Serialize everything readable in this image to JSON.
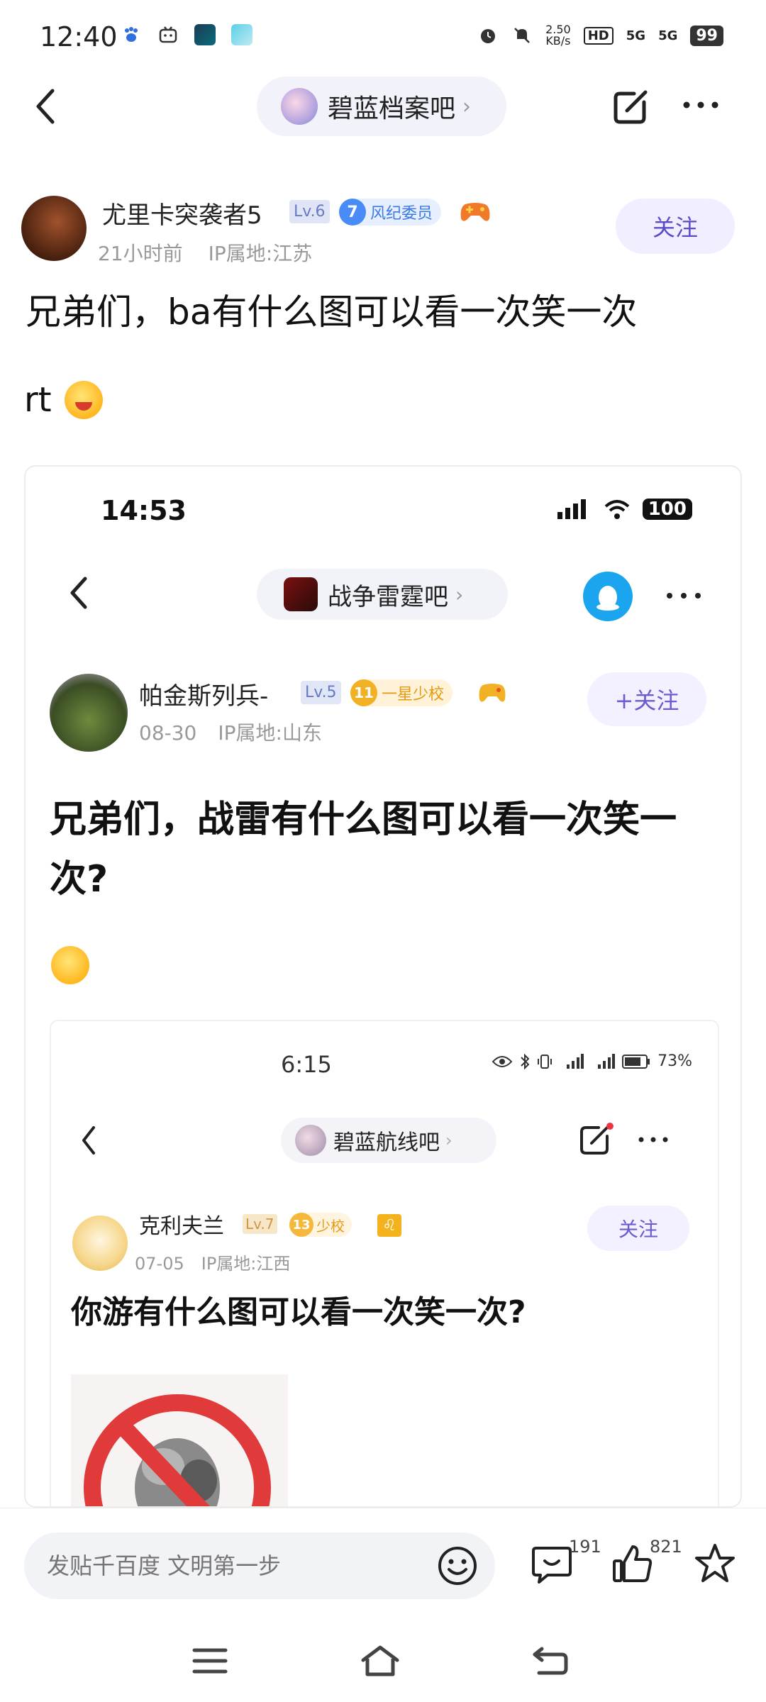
{
  "status_bar": {
    "time": "12:40",
    "net_speed_top": "2.50",
    "net_speed_bottom": "KB/s",
    "hd": "HD",
    "net1": "5G",
    "net2": "5G",
    "battery": "99"
  },
  "nav": {
    "forum_name": "碧蓝档案吧",
    "chevron": "›"
  },
  "post": {
    "author": "尤里卡突袭者5",
    "level": "Lv.6",
    "honor_level": "7",
    "honor_title": "风纪委员",
    "follow_label": "关注",
    "time_ago": "21小时前",
    "ip": "IP属地:江苏",
    "title": "兄弟们，ba有什么图可以看一次笑一次",
    "body": "rt"
  },
  "embedded_1": {
    "time": "14:53",
    "battery": "100",
    "forum_name": "战争雷霆吧",
    "chevron": "›",
    "author": "帕金斯列兵-",
    "level": "Lv.5",
    "rank_num": "11",
    "rank_title": "一星少校",
    "follow_label": "+关注",
    "date": "08-30",
    "ip": "IP属地:山东",
    "title": "兄弟们，战雷有什么图可以看一次笑一次?"
  },
  "embedded_2": {
    "time": "6:15",
    "battery": "73%",
    "forum_name": "碧蓝航线吧",
    "chevron": "›",
    "author": "克利夫兰",
    "level": "Lv.7",
    "rank_num": "13",
    "rank_title": "少校",
    "zodiac": "♌",
    "follow_label": "关注",
    "date": "07-05",
    "ip": "IP属地:江西",
    "title": "你游有什么图可以看一次笑一次?"
  },
  "bottom": {
    "input_placeholder": "发贴千百度 文明第一步",
    "comment_count": "191",
    "like_count": "821"
  },
  "colors": {
    "accent": "#5a4cc7",
    "pill_bg": "#f1f2fa"
  }
}
